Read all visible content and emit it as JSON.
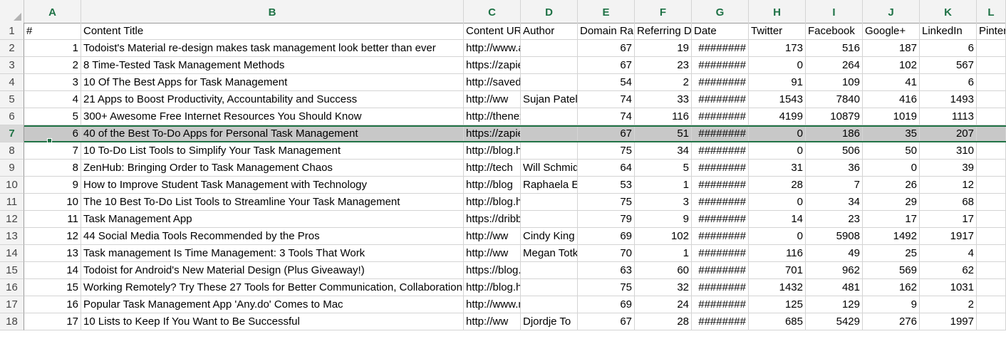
{
  "columns": [
    "A",
    "B",
    "C",
    "D",
    "E",
    "F",
    "G",
    "H",
    "I",
    "J",
    "K",
    "L"
  ],
  "header_row": [
    "#",
    "Content Title",
    "Content URL",
    "Author",
    "Domain Rank",
    "Referring Domains",
    "Date",
    "Twitter",
    "Facebook",
    "Google+",
    "LinkedIn",
    "Pinterest"
  ],
  "rows": [
    [
      "1",
      "Todoist's Material re-design makes task management look better than ever",
      "http://www.androidcentral.com",
      "",
      "67",
      "19",
      "########",
      "173",
      "516",
      "187",
      "6",
      ""
    ],
    [
      "2",
      "8 Time-Tested Task Management Methods",
      "https://zapier.com/blog",
      "",
      "67",
      "23",
      "########",
      "0",
      "264",
      "102",
      "567",
      ""
    ],
    [
      "3",
      "10 Of The Best Apps for Task Management",
      "http://savedelete.com",
      "",
      "54",
      "2",
      "########",
      "91",
      "109",
      "41",
      "6",
      ""
    ],
    [
      "4",
      "21 Apps to Boost Productivity, Accountability and Success",
      "http://ww",
      "Sujan Patel",
      "74",
      "33",
      "########",
      "1543",
      "7840",
      "416",
      "1493",
      ""
    ],
    [
      "5",
      "300+ Awesome Free Internet Resources You Should Know",
      "http://thenextweb.com",
      "",
      "74",
      "116",
      "########",
      "4199",
      "10879",
      "1019",
      "1113",
      ""
    ],
    [
      "6",
      "40 of the Best To-Do Apps for Personal Task Management",
      "https://zapier.com/blog",
      "",
      "67",
      "51",
      "########",
      "0",
      "186",
      "35",
      "207",
      ""
    ],
    [
      "7",
      "10 To-Do List Tools to Simplify Your Task Management",
      "http://blog.hubspot.com",
      "",
      "75",
      "34",
      "########",
      "0",
      "506",
      "50",
      "310",
      ""
    ],
    [
      "8",
      "ZenHub: Bringing Order to Task Management Chaos",
      "http://tech",
      "Will Schmidt",
      "64",
      "5",
      "########",
      "31",
      "36",
      "0",
      "39",
      ""
    ],
    [
      "9",
      "How to Improve Student Task Management with Technology",
      "http://blog",
      "Raphaela E",
      "53",
      "1",
      "########",
      "28",
      "7",
      "26",
      "12",
      ""
    ],
    [
      "10",
      "The 10 Best To-Do List Tools to Streamline Your Task Management",
      "http://blog.hubspot.com",
      "",
      "75",
      "3",
      "########",
      "0",
      "34",
      "29",
      "68",
      ""
    ],
    [
      "11",
      "Task Management App",
      "https://dribbble.com/",
      "",
      "79",
      "9",
      "########",
      "14",
      "23",
      "17",
      "17",
      ""
    ],
    [
      "12",
      "44 Social Media Tools Recommended by the Pros",
      "http://ww",
      "Cindy King",
      "69",
      "102",
      "########",
      "0",
      "5908",
      "1492",
      "1917",
      ""
    ],
    [
      "13",
      "Task management Is Time Management: 3 Tools That Work",
      "http://ww",
      "Megan Totka",
      "70",
      "1",
      "########",
      "116",
      "49",
      "25",
      "4",
      ""
    ],
    [
      "14",
      "Todoist for Android's New Material Design (Plus Giveaway!)",
      "https://blog.todoist.com",
      "",
      "63",
      "60",
      "########",
      "701",
      "962",
      "569",
      "62",
      ""
    ],
    [
      "15",
      "Working Remotely? Try These 27 Tools for Better Communication, Collaboration",
      "http://blog.hubspot.com",
      "",
      "75",
      "32",
      "########",
      "1432",
      "481",
      "162",
      "1031",
      ""
    ],
    [
      "16",
      "Popular Task Management App 'Any.do' Comes to Mac",
      "http://www.macrumors.com",
      "",
      "69",
      "24",
      "########",
      "125",
      "129",
      "9",
      "2",
      ""
    ],
    [
      "17",
      "10 Lists to Keep If You Want to Be Successful",
      "http://ww",
      "Djordje To",
      "67",
      "28",
      "########",
      "685",
      "5429",
      "276",
      "1997",
      ""
    ]
  ],
  "selected_row": 7
}
